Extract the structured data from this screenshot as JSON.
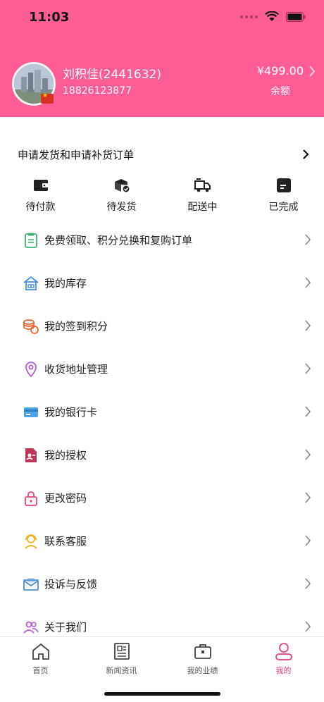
{
  "status_bar": {
    "time": "11:03"
  },
  "profile": {
    "name": "刘积佳(2441632)",
    "phone": "18826123877",
    "balance": "¥499.00",
    "balance_label": "余额"
  },
  "orders": {
    "title": "申请发货和申请补货订单",
    "statuses": [
      {
        "label": "待付款",
        "icon": "wallet-icon"
      },
      {
        "label": "待发货",
        "icon": "package-check-icon"
      },
      {
        "label": "配送中",
        "icon": "delivery-truck-icon"
      },
      {
        "label": "已完成",
        "icon": "save-box-icon"
      }
    ]
  },
  "menu": [
    {
      "label": "免费领取、积分兑换和复购订单",
      "icon": "clipboard-icon",
      "color": "#3cb371"
    },
    {
      "label": "我的库存",
      "icon": "warehouse-icon",
      "color": "#4a90d9"
    },
    {
      "label": "我的签到积分",
      "icon": "coins-icon",
      "color": "#f0642e"
    },
    {
      "label": "收货地址管理",
      "icon": "location-pin-icon",
      "color": "#b05ad6"
    },
    {
      "label": "我的银行卡",
      "icon": "bank-card-icon",
      "color": "#4aa8e8"
    },
    {
      "label": "我的授权",
      "icon": "authorization-icon",
      "color": "#c0345a"
    },
    {
      "label": "更改密码",
      "icon": "lock-icon",
      "color": "#e8457a"
    },
    {
      "label": "联系客服",
      "icon": "customer-service-icon",
      "color": "#f0b21e"
    },
    {
      "label": "投诉与反馈",
      "icon": "mail-feedback-icon",
      "color": "#4a90d9"
    },
    {
      "label": "关于我们",
      "icon": "people-icon",
      "color": "#b05ad6"
    }
  ],
  "tabbar": {
    "items": [
      {
        "label": "首页",
        "icon": "home-icon"
      },
      {
        "label": "新闻资讯",
        "icon": "news-icon"
      },
      {
        "label": "我的业绩",
        "icon": "briefcase-icon"
      },
      {
        "label": "我的",
        "icon": "user-icon"
      }
    ],
    "active": "我的"
  },
  "colors": {
    "header": "#fd5d94",
    "active_tab": "#e83e8c"
  }
}
